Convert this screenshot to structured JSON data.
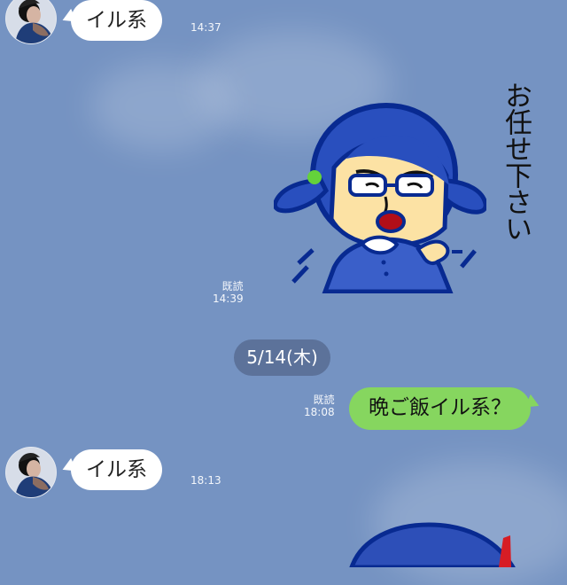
{
  "messages": [
    {
      "text": "イル系",
      "time": "14:37"
    },
    {
      "sticker_caption": "お任せ下さい",
      "read": "既読",
      "time": "14:39"
    },
    {
      "date": "5/14(木)"
    },
    {
      "text": "晩ご飯イル系？",
      "read": "既読",
      "time": "18:08"
    },
    {
      "text": "イル系",
      "time": "18:13"
    }
  ],
  "colors": {
    "background": "#7593c2",
    "incoming_bubble": "#ffffff",
    "outgoing_bubble": "#86d65f",
    "date_pill": "#5c729a"
  },
  "icons": {
    "avatar": "profile-photo",
    "sticker": "girl-sticker",
    "bottom_sticker": "partial-sticker"
  }
}
